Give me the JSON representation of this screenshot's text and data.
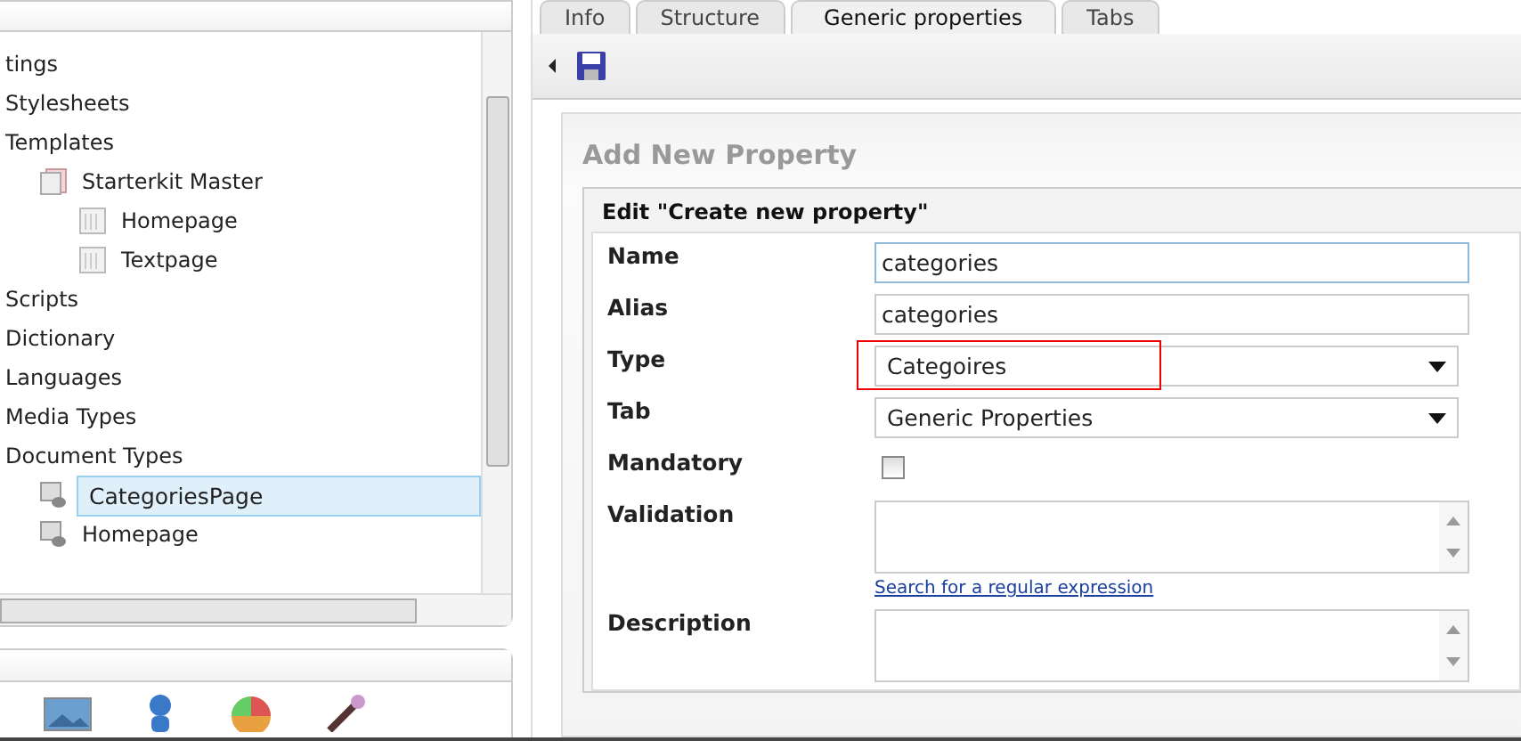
{
  "sidebar": {
    "tree": [
      {
        "label": "tings",
        "selected": false,
        "children": [
          {
            "label": "Stylesheets",
            "selected": false
          },
          {
            "label": "Templates",
            "selected": false,
            "children": [
              {
                "label": "Starterkit Master",
                "kind": "template",
                "selected": false,
                "children": [
                  {
                    "label": "Homepage",
                    "kind": "page",
                    "selected": false
                  },
                  {
                    "label": "Textpage",
                    "kind": "page",
                    "selected": false
                  }
                ]
              }
            ]
          },
          {
            "label": "Scripts",
            "selected": false
          },
          {
            "label": "Dictionary",
            "selected": false
          },
          {
            "label": "Languages",
            "selected": false
          },
          {
            "label": "Media Types",
            "selected": false
          },
          {
            "label": "Document Types",
            "selected": false,
            "children": [
              {
                "label": "CategoriesPage",
                "kind": "doctype",
                "selected": true
              },
              {
                "label": "Homepage",
                "kind": "doctype",
                "selected": false
              }
            ]
          }
        ]
      }
    ]
  },
  "tabs": [
    {
      "label": "Info",
      "selected": false
    },
    {
      "label": "Structure",
      "selected": false
    },
    {
      "label": "Generic properties",
      "selected": true
    },
    {
      "label": "Tabs",
      "selected": false
    }
  ],
  "panel": {
    "title": "Add New Property",
    "box_title": "Edit \"Create new property\"",
    "fields": [
      {
        "label": "Name",
        "kind": "text",
        "value": "categories",
        "focused": true
      },
      {
        "label": "Alias",
        "kind": "text",
        "value": "categories",
        "focused": false
      },
      {
        "label": "Type",
        "kind": "select",
        "value": "Categoires",
        "highlighted": true
      },
      {
        "label": "Tab",
        "kind": "select",
        "value": "Generic Properties",
        "highlighted": false
      },
      {
        "label": "Mandatory",
        "kind": "checkbox",
        "checked": false
      },
      {
        "label": "Validation",
        "kind": "textarea",
        "link": "Search for a regular expression"
      },
      {
        "label": "Description",
        "kind": "textarea"
      }
    ]
  }
}
